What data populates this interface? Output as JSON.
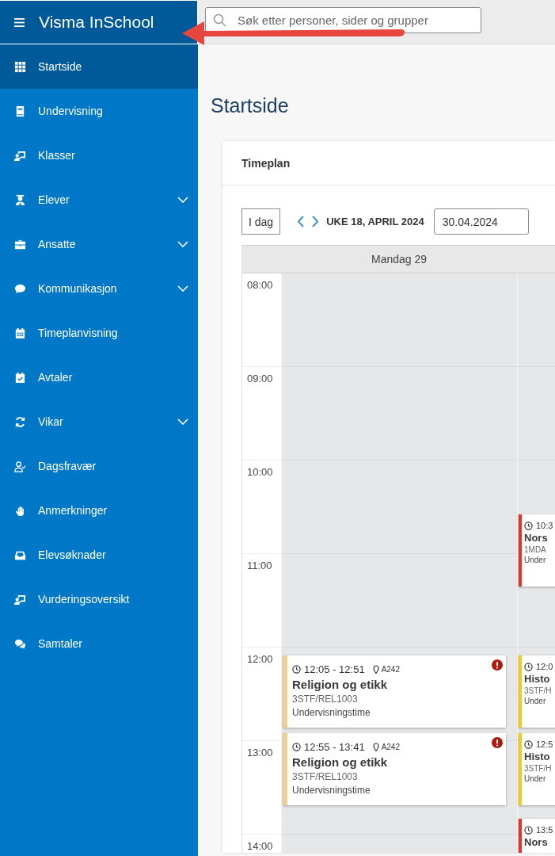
{
  "app": {
    "title": "Visma InSchool"
  },
  "sidebar": {
    "items": [
      {
        "label": "Startside",
        "kind": "link",
        "selected": true
      },
      {
        "label": "Undervisning",
        "kind": "link",
        "selected": false
      },
      {
        "label": "Klasser",
        "kind": "link",
        "selected": false
      },
      {
        "label": "Elever",
        "kind": "group",
        "selected": false
      },
      {
        "label": "Ansatte",
        "kind": "group",
        "selected": false
      },
      {
        "label": "Kommunikasjon",
        "kind": "group",
        "selected": false
      },
      {
        "label": "Timeplanvisning",
        "kind": "link",
        "selected": false
      },
      {
        "label": "Avtaler",
        "kind": "link",
        "selected": false
      },
      {
        "label": "Vikar",
        "kind": "group",
        "selected": false
      },
      {
        "label": "Dagsfravær",
        "kind": "link",
        "selected": false
      },
      {
        "label": "Anmerkninger",
        "kind": "link",
        "selected": false
      },
      {
        "label": "Elevsøknader",
        "kind": "link",
        "selected": false
      },
      {
        "label": "Vurderingsoversikt",
        "kind": "link",
        "selected": false
      },
      {
        "label": "Samtaler",
        "kind": "link",
        "selected": false
      }
    ]
  },
  "search": {
    "placeholder": "Søk etter personer, sider og grupper"
  },
  "page": {
    "title": "Startside"
  },
  "timetable": {
    "title": "Timeplan",
    "today_button": "I dag",
    "week_label": "UKE 18, APRIL 2024",
    "date": "30.04.2024",
    "hours": [
      "08:00",
      "09:00",
      "10:00",
      "11:00",
      "12:00",
      "13:00",
      "14:00"
    ],
    "days": [
      {
        "label": "Mandag 29",
        "events": [
          {
            "time": "12:05 - 12:51",
            "room": "A242",
            "title": "Religion og etikk",
            "code": "3STF/REL1003",
            "type": "Undervisningstime",
            "color": "#f0cf90",
            "alert": true
          },
          {
            "time": "12:55 - 13:41",
            "room": "A242",
            "title": "Religion og etikk",
            "code": "3STF/REL1003",
            "type": "Undervisningstime",
            "color": "#f0cf90",
            "alert": true
          }
        ]
      },
      {
        "events": [
          {
            "time": "10:3",
            "title": "Nors",
            "code": "1MDA",
            "type": "Under",
            "color": "#e8302f",
            "alert": false
          },
          {
            "time": "12:0",
            "title": "Histo",
            "code": "3STF/H",
            "type": "Under",
            "color": "#f5cc14",
            "alert": false
          },
          {
            "time": "12:5",
            "title": "Histo",
            "code": "3STF/H",
            "type": "Under",
            "color": "#f5cc14",
            "alert": false
          },
          {
            "time": "13:5",
            "title": "Nors",
            "color": "#e8302f",
            "alert": false
          }
        ]
      }
    ]
  }
}
